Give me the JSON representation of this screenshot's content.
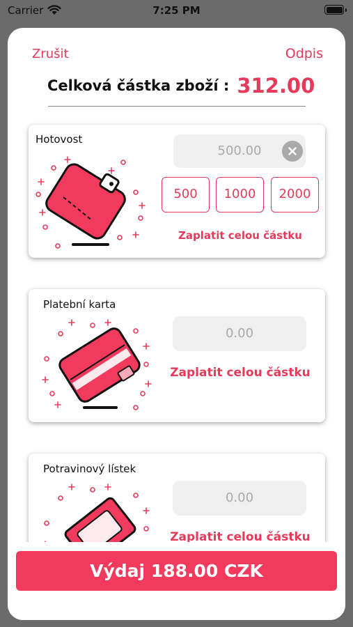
{
  "status_bar": {
    "carrier": "Carrier",
    "time": "7:25 PM"
  },
  "nav": {
    "cancel_label": "Zrušit",
    "writeoff_label": "Odpis"
  },
  "total": {
    "label": "Celková částka zboží :",
    "value": "312.00"
  },
  "cash": {
    "title": "Hotovost",
    "amount": "500.00",
    "quick_amounts": [
      "500",
      "1000",
      "2000"
    ],
    "pay_full_label": "Zaplatit celou částku"
  },
  "card_payment": {
    "title": "Platební karta",
    "amount": "0.00",
    "pay_full_label": "Zaplatit celou částku"
  },
  "voucher": {
    "title": "Potravinový lístek",
    "amount": "0.00",
    "pay_full_label": "Zaplatit celou částku"
  },
  "issue_button_label": "Výdaj 188.00 CZK",
  "colors": {
    "accent": "#e53a5a",
    "button": "#f23a5c",
    "field": "#efefef"
  },
  "icons": {
    "cash": "wallet-icon",
    "card": "credit-card-icon",
    "voucher": "banknote-icon",
    "clear": "clear-icon"
  }
}
